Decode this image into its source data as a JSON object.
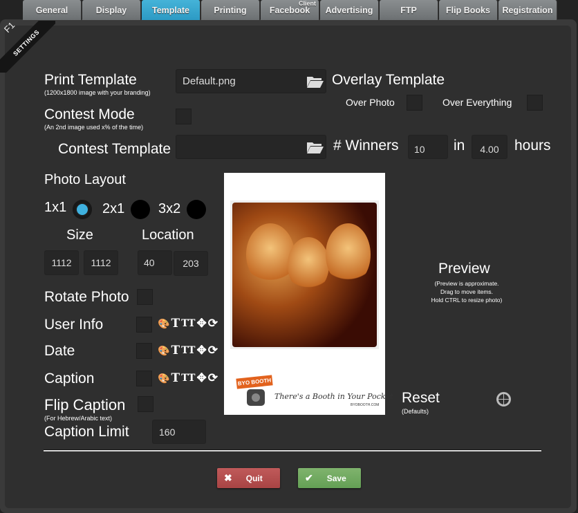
{
  "tabs": [
    {
      "label": "General",
      "active": false
    },
    {
      "label": "Display",
      "active": false
    },
    {
      "label": "Template",
      "active": true
    },
    {
      "label": "Printing",
      "active": false
    },
    {
      "label": "Facebook",
      "superscript": "Client",
      "active": false
    },
    {
      "label": "Advertising",
      "active": false
    },
    {
      "label": "FTP",
      "active": false
    },
    {
      "label": "Flip Books",
      "active": false
    },
    {
      "label": "Registration",
      "active": false
    }
  ],
  "ribbon": {
    "key": "F1",
    "label": "SETTINGS"
  },
  "print_template": {
    "label": "Print Template",
    "hint": "(1200x1800 image with your branding)",
    "value": "Default.png",
    "browse_icon": "folder-open-icon"
  },
  "overlay_template": {
    "label": "Overlay Template",
    "over_photo": "Over Photo",
    "over_photo_checked": false,
    "over_everything": "Over Everything",
    "over_everything_checked": false
  },
  "contest_mode": {
    "label": "Contest Mode",
    "hint": "(An 2nd image used x% of the time)",
    "checked": false
  },
  "contest_template": {
    "label": "Contest Template",
    "value": "",
    "browse_icon": "folder-open-icon"
  },
  "winners": {
    "label": "# Winners",
    "count": "10",
    "in_label": "in",
    "hours": "4.00",
    "hours_label": "hours"
  },
  "photo_layout": {
    "label": "Photo Layout",
    "options": [
      {
        "label": "1x1",
        "selected": true
      },
      {
        "label": "2x1",
        "selected": false
      },
      {
        "label": "3x2",
        "selected": false
      }
    ],
    "size_label": "Size",
    "location_label": "Location",
    "size_w": "1112",
    "size_h": "1112",
    "loc_x": "40",
    "loc_y": "203"
  },
  "rotate_photo": {
    "label": "Rotate Photo",
    "checked": false
  },
  "user_info": {
    "label": "User Info",
    "checked": false
  },
  "date": {
    "label": "Date",
    "checked": false
  },
  "caption": {
    "label": "Caption",
    "checked": false
  },
  "text_tools": [
    "palette-icon",
    "font-icon",
    "font-size-icon",
    "move-icon",
    "rotate-icon"
  ],
  "text_tool_glyphs": {
    "palette": "🎨",
    "font": "T",
    "size": "TT",
    "move": "✥",
    "rotate": "⟳"
  },
  "flip_caption": {
    "label": "Flip Caption",
    "hint": "(For Hebrew/Arabic text)",
    "checked": false
  },
  "caption_limit": {
    "label": "Caption Limit",
    "value": "160"
  },
  "preview": {
    "title": "Preview",
    "note_lines": [
      "(Preview is approximate.",
      "Drag to move items.",
      "Hold CTRL to resize photo)"
    ],
    "brand_badge": "BYO BOOTH",
    "tagline": "There's a Booth in Your Pocket",
    "site": "BYOBOOTH.COM"
  },
  "reset": {
    "label": "Reset",
    "hint": "(Defaults)"
  },
  "buttons": {
    "quit": "Quit",
    "save": "Save",
    "quit_icon": "✖",
    "save_icon": "✔"
  }
}
